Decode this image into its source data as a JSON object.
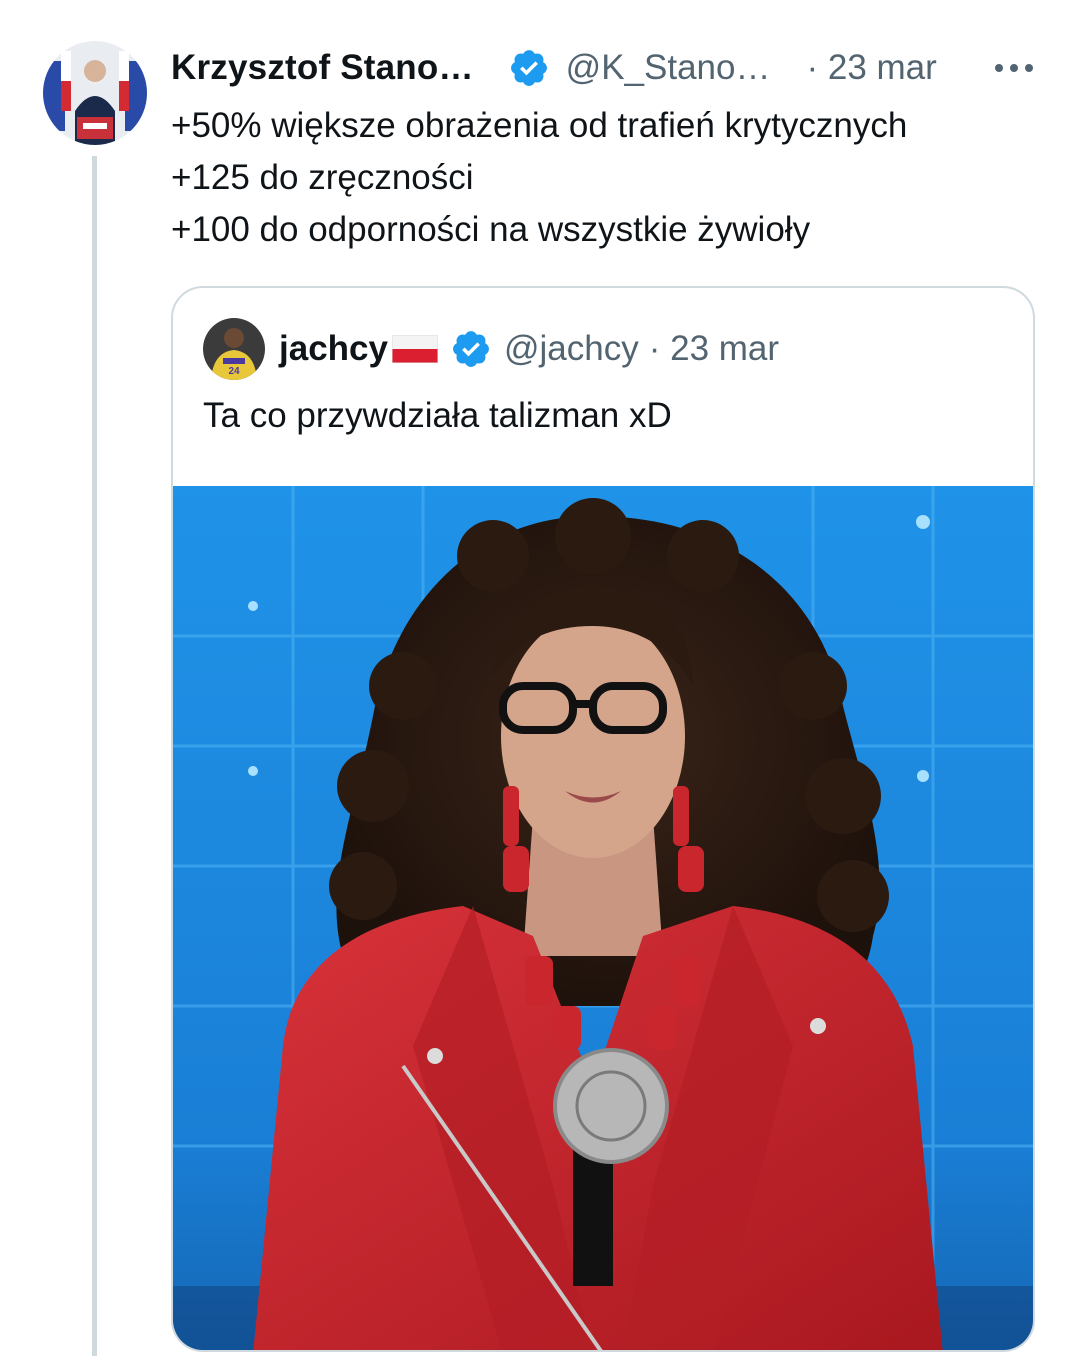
{
  "tweet": {
    "author_name": "Krzysztof Stano…",
    "handle": "@K_Stano…",
    "date": "· 23 mar",
    "lines": [
      "+50% większe obrażenia od trafień krytycznych",
      "+125 do zręczności",
      "+100 do odporności na wszystkie żywioły"
    ],
    "icons": {
      "verified": "verified-badge-icon",
      "more": "more-options-icon"
    }
  },
  "quote": {
    "author_name": "jachcy",
    "handle": "@jachcy",
    "date": "· 23 mar",
    "text": "Ta co przywdziała talizman xD",
    "icons": {
      "flag": "poland-flag-icon",
      "verified": "verified-badge-icon"
    }
  },
  "colors": {
    "verified_blue": "#1d9bf0",
    "secondary_text": "#536471",
    "thread_line": "#cfd9de",
    "media_background_blue": "#1c8fe3",
    "jacket_red": "#c9242c"
  }
}
